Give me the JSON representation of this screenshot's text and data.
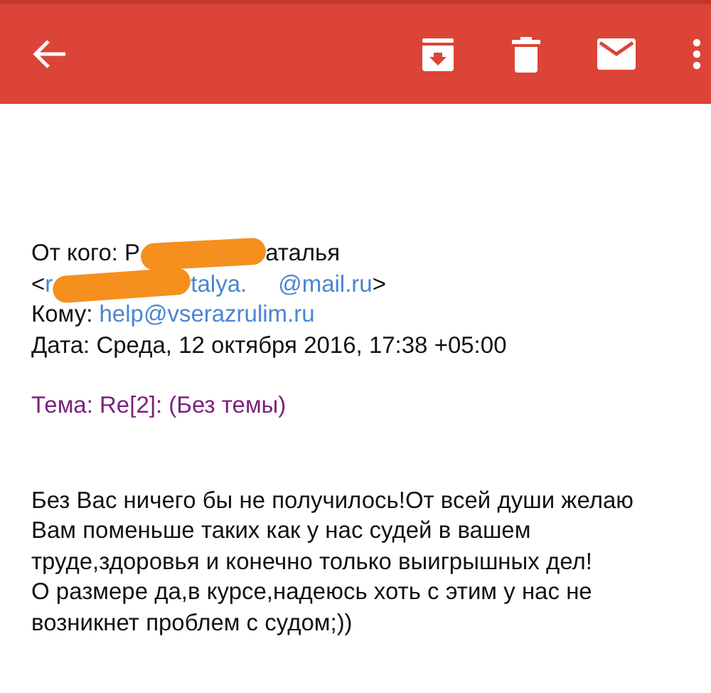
{
  "sender": {
    "label": "От кого:",
    "visible_start": "Р",
    "visible_end": "аталья",
    "redacted": true
  },
  "sender_address": {
    "open": "<",
    "visible_start": "r",
    "visible_middle": "talya.",
    "visible_end": "@mail.ru",
    "close": ">",
    "redacted": true
  },
  "recipient": {
    "label": "Кому:",
    "address": "help@vserazrulim.ru"
  },
  "date": {
    "label": "Дата:",
    "value": "Среда, 12 октября 2016, 17:38 +05:00"
  },
  "subject": "Тема: Re[2]: (Без темы)",
  "body_lines": [
    "Без Вас ничего бы не получилось!От всей души желаю",
    "Вам поменьше таких как у нас судей в вашем",
    "труде,здоровья и конечно только выигрышных дел!",
    "О размере да,в курсе,надеюсь хоть с этим у нас не",
    "возникнет проблем с судом;))"
  ]
}
